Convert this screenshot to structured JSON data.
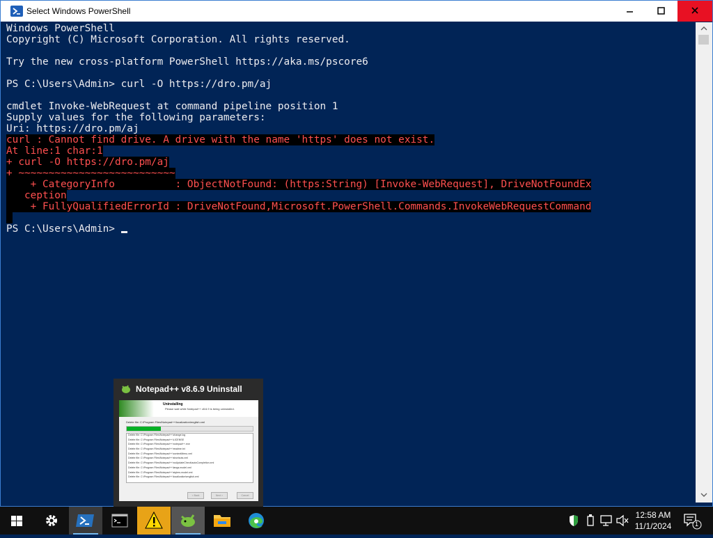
{
  "window": {
    "title": "Select Windows PowerShell",
    "icon": "powershell-icon",
    "controls": [
      "minimize-icon",
      "maximize-icon",
      "close-icon"
    ],
    "colors": {
      "background": "#012456",
      "text": "#eeedf0",
      "error_text": "#ff5050",
      "close": "#e81123"
    }
  },
  "console": {
    "lines": [
      {
        "text": "Windows PowerShell",
        "type": "normal"
      },
      {
        "text": "Copyright (C) Microsoft Corporation. All rights reserved.",
        "type": "normal"
      },
      {
        "text": "",
        "type": "normal"
      },
      {
        "text": "Try the new cross-platform PowerShell https://aka.ms/pscore6",
        "type": "normal"
      },
      {
        "text": "",
        "type": "normal"
      },
      {
        "text": "PS C:\\Users\\Admin> curl -O https://dro.pm/aj",
        "type": "normal"
      },
      {
        "text": "",
        "type": "normal"
      },
      {
        "text": "cmdlet Invoke-WebRequest at command pipeline position 1",
        "type": "normal"
      },
      {
        "text": "Supply values for the following parameters:",
        "type": "normal"
      },
      {
        "text": "Uri: https://dro.pm/aj",
        "type": "normal"
      },
      {
        "text": "curl : Cannot find drive. A drive with the name 'https' does not exist.",
        "type": "error"
      },
      {
        "text": "At line:1 char:1",
        "type": "error"
      },
      {
        "text": "+ curl -O https://dro.pm/aj",
        "type": "error"
      },
      {
        "text": "+ ~~~~~~~~~~~~~~~~~~~~~~~~~~",
        "type": "error"
      },
      {
        "text": "    + CategoryInfo          : ObjectNotFound: (https:String) [Invoke-WebRequest], DriveNotFoundEx",
        "type": "error"
      },
      {
        "text": "   ception",
        "type": "error"
      },
      {
        "text": "    + FullyQualifiedErrorId : DriveNotFound,Microsoft.PowerShell.Commands.InvokeWebRequestCommand",
        "type": "error"
      },
      {
        "text": " ",
        "type": "error"
      },
      {
        "text": "PS C:\\Users\\Admin> ",
        "type": "prompt"
      }
    ]
  },
  "preview": {
    "title": "Notepad++ v8.6.9 Uninstall",
    "icon": "notepadpp-icon",
    "thumb_heading": "Uninstalling",
    "thumb_subheading": "Please wait while Notepad++ v8.6.9 is being uninstalled.",
    "thumb_current_file": "Delete file: C:\\Program Files\\Notepad++\\localization\\english.xml",
    "thumb_progress": 0.27,
    "thumb_files": [
      "Delete file: C:\\Program Files\\Notepad++\\change.log",
      "Delete file: C:\\Program Files\\Notepad++\\LICENSE",
      "Delete file: C:\\Program Files\\Notepad++\\notepad++.exe",
      "Delete file: C:\\Program Files\\Notepad++\\readme.txt",
      "Delete file: C:\\Program Files\\Notepad++\\contextMenu.xml",
      "Delete file: C:\\Program Files\\Notepad++\\shortcuts.xml",
      "Delete file: C:\\Program Files\\Notepad++\\noUpdateCheck\\autoCompletion.xml",
      "Delete file: C:\\Program Files\\Notepad++\\langs.model.xml",
      "Delete file: C:\\Program Files\\Notepad++\\stylers.model.xml",
      "Delete file: C:\\Program Files\\Notepad++\\localization\\english.xml"
    ],
    "thumb_buttons": [
      "< Back",
      "Next >",
      "Cancel"
    ]
  },
  "taskbar": {
    "items": [
      {
        "name": "start-button",
        "icon": "windows-logo-icon"
      },
      {
        "name": "settings-button",
        "icon": "gear-icon"
      },
      {
        "name": "powershell-taskbar-button",
        "icon": "powershell-icon"
      },
      {
        "name": "cmd-taskbar-button",
        "icon": "command-prompt-icon"
      },
      {
        "name": "warning-taskbar-button",
        "icon": "warning-icon"
      },
      {
        "name": "notepadpp-taskbar-button",
        "icon": "notepadpp-icon"
      },
      {
        "name": "file-explorer-button",
        "icon": "folder-icon"
      },
      {
        "name": "edge-button",
        "icon": "edge-icon"
      }
    ],
    "tray_icons": [
      "security-shield-icon",
      "usb-device-icon",
      "network-icon",
      "volume-muted-icon"
    ],
    "time": "12:58 AM",
    "date": "11/1/2024",
    "notification_count": "1",
    "notification_icon": "action-center-icon"
  }
}
